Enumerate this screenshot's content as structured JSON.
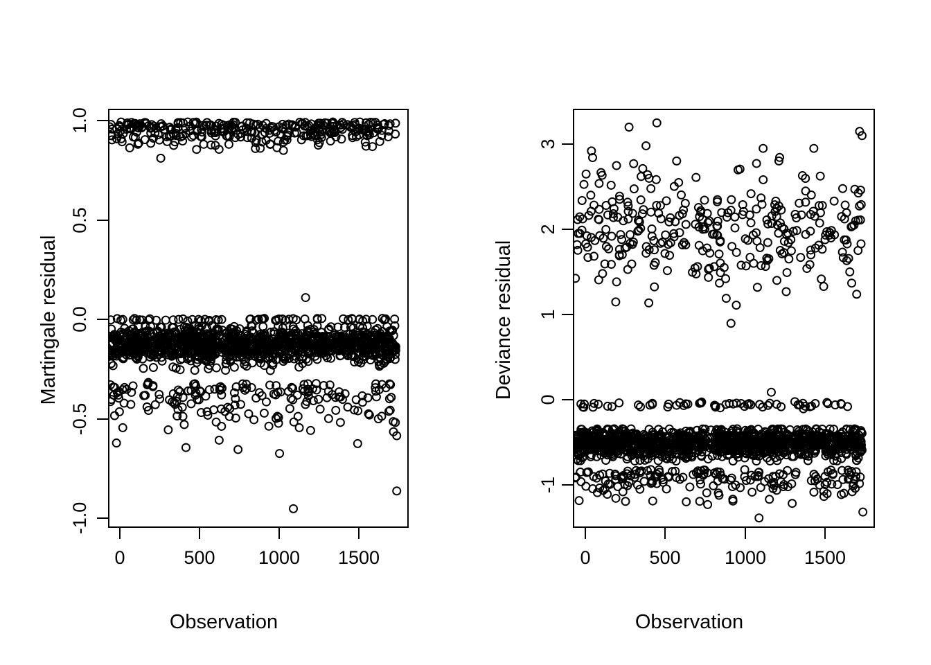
{
  "figure": {
    "background": "#ffffff",
    "foreground": "#000000",
    "panels": 2
  },
  "chart_data": [
    {
      "type": "scatter",
      "panel": "left",
      "title": "",
      "xlabel": "Observation",
      "ylabel": "Martingale residual",
      "xlim": [
        -45,
        1785
      ],
      "ylim": [
        -1.05,
        1.06
      ],
      "xticks": [
        0,
        500,
        1000,
        1500
      ],
      "xticklabels": [
        "0",
        "500",
        "1000",
        "1500"
      ],
      "yticks": [
        -1.0,
        -0.5,
        0.0,
        0.5,
        1.0
      ],
      "yticklabels": [
        "-1.0",
        "-0.5",
        "0.0",
        "0.5",
        "1.0"
      ],
      "grid": false,
      "legend": null,
      "marker": "open-circle",
      "marker_size": 11,
      "marker_color": "#000000",
      "n_points": 1740,
      "description": "Martingale residuals vs observation index. Upper band of censored/event points near 0.85 to 1.0, a dense band just below 0.0 (approx -0.05 to -0.22), plus scattered outliers down to -0.96.",
      "clusters": [
        {
          "name": "event-band-top",
          "n": 320,
          "y_center": 0.95,
          "y_spread": 0.06,
          "y_min": 0.58,
          "y_max": 1.0
        },
        {
          "name": "zero-line",
          "n": 60,
          "y_center": 0.0,
          "y_spread": 0.005,
          "y_min": -0.01,
          "y_max": 0.005
        },
        {
          "name": "dense-censored-band",
          "n": 1180,
          "y_center": -0.13,
          "y_spread": 0.045,
          "y_min": -0.26,
          "y_max": -0.03
        },
        {
          "name": "lower-tail",
          "n": 180,
          "y_center": -0.32,
          "y_spread": 0.12,
          "y_min": -0.96,
          "y_max": -0.22
        }
      ],
      "notable_outliers": [
        {
          "x": 1085,
          "y": -0.96
        },
        {
          "x": 1720,
          "y": -0.87
        },
        {
          "x": 1160,
          "y": 0.11
        },
        {
          "x": 425,
          "y": -0.65
        },
        {
          "x": 745,
          "y": -0.66
        },
        {
          "x": 1000,
          "y": -0.68
        },
        {
          "x": 1480,
          "y": -0.63
        },
        {
          "x": 1700,
          "y": -0.57
        },
        {
          "x": 1720,
          "y": -0.59
        }
      ]
    },
    {
      "type": "scatter",
      "panel": "right",
      "title": "",
      "xlabel": "Observation",
      "ylabel": "Deviance residual",
      "xlim": [
        -45,
        1785
      ],
      "ylim": [
        -1.45,
        3.45
      ],
      "xticks": [
        0,
        500,
        1000,
        1500
      ],
      "xticklabels": [
        "0",
        "500",
        "1000",
        "1500"
      ],
      "yticks": [
        -1,
        0,
        1,
        2,
        3
      ],
      "yticklabels": [
        "-1",
        "0",
        "1",
        "2",
        "3"
      ],
      "grid": false,
      "legend": null,
      "marker": "open-circle",
      "marker_size": 11,
      "marker_color": "#000000",
      "n_points": 1740,
      "description": "Deviance residuals vs observation index. Diffuse upper cloud centered near 2.0 ranging 0.8 to 3.3, a row of points at 0 and a dense band near -0.45, with a lower tail down to -1.35.",
      "clusters": [
        {
          "name": "event-cloud-top",
          "n": 320,
          "y_center": 2.0,
          "y_spread": 0.38,
          "y_min": 0.85,
          "y_max": 3.3
        },
        {
          "name": "zero-line",
          "n": 60,
          "y_center": -0.02,
          "y_spread": 0.02,
          "y_min": -0.1,
          "y_max": 0.02
        },
        {
          "name": "dense-censored-band",
          "n": 1180,
          "y_center": -0.47,
          "y_spread": 0.09,
          "y_min": -0.68,
          "y_max": -0.3
        },
        {
          "name": "lower-tail",
          "n": 180,
          "y_center": -0.78,
          "y_spread": 0.16,
          "y_min": -1.35,
          "y_max": -0.62
        }
      ],
      "notable_outliers": [
        {
          "x": 460,
          "y": 3.3
        },
        {
          "x": 1700,
          "y": 3.2
        },
        {
          "x": 1715,
          "y": 3.15
        },
        {
          "x": 290,
          "y": 3.25
        },
        {
          "x": 60,
          "y": 2.97
        },
        {
          "x": 1110,
          "y": 3.0
        },
        {
          "x": 1420,
          "y": 3.0
        },
        {
          "x": 1085,
          "y": -1.35
        },
        {
          "x": 1720,
          "y": -1.28
        },
        {
          "x": 435,
          "y": -1.15
        },
        {
          "x": 640,
          "y": -1.16
        },
        {
          "x": 1160,
          "y": 0.13
        }
      ]
    }
  ]
}
